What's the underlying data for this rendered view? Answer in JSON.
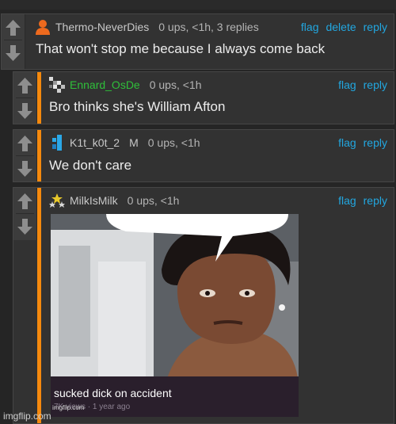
{
  "comments": [
    {
      "username": "Thermo-NeverDies",
      "avatar": "orange-user-icon",
      "meta": "0 ups, <1h, 3 replies",
      "actions": [
        "flag",
        "delete",
        "reply"
      ],
      "text": "That won't stop me because I always come back"
    },
    {
      "username": "Ennard_OsDe",
      "avatar": "pixel-avatar-icon",
      "meta": "0 ups, <1h",
      "actions": [
        "flag",
        "reply"
      ],
      "text": "Bro thinks she's William Afton"
    },
    {
      "username": "K1t_k0t_2",
      "avatar": "blue-pixel-avatar-icon",
      "badge": "M",
      "meta": "0 ups, <1h",
      "actions": [
        "flag",
        "reply"
      ],
      "text": "We don't care"
    },
    {
      "username": "MilkIsMilk",
      "avatar": "stars-avatar-icon",
      "meta": "0 ups, <1h",
      "actions": [
        "flag",
        "reply"
      ],
      "image": {
        "caption": "sucked dick on accident",
        "subcaption": "7K views · 1 year ago",
        "watermark": "imgflip.com"
      }
    }
  ],
  "footer_watermark": "imgflip.com",
  "colors": {
    "link": "#22a7e0",
    "thread_bar": "#f5890d",
    "username_green": "#2fbf3a",
    "background": "#252525",
    "comment_bg": "#323232"
  }
}
